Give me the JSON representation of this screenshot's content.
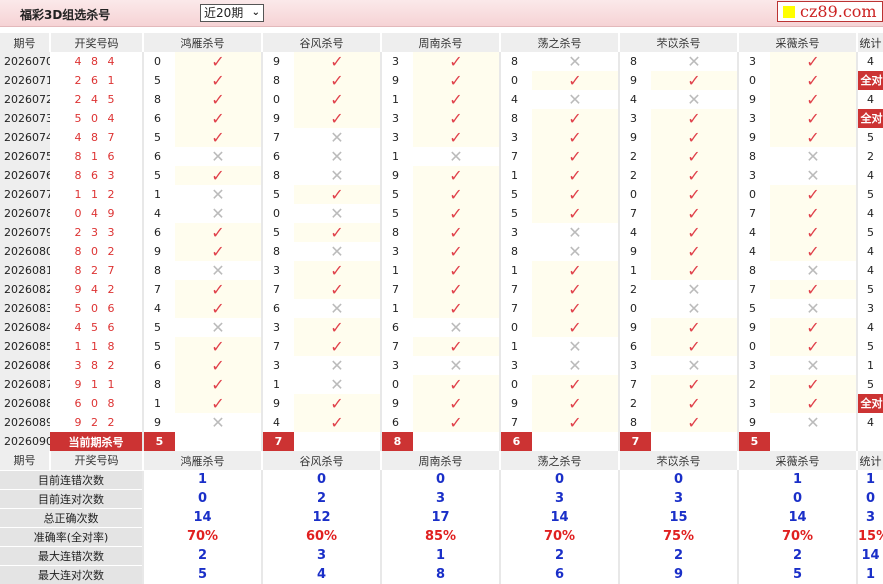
{
  "header": {
    "title": "福彩3D组选杀号",
    "period_select": "近20期",
    "logo": "cz89.com"
  },
  "columns": {
    "issue": "期号",
    "draw": "开奖号码",
    "experts": [
      "鸿雁杀号",
      "谷风杀号",
      "周南杀号",
      "荡之杀号",
      "芣苡杀号",
      "采薇杀号"
    ],
    "stat": "统计"
  },
  "marks": {
    "ok": "✓",
    "bad": "✕"
  },
  "colors": {
    "accent": "#cc3333",
    "ok": "#e0404a",
    "stat_blue": "#1a2fc8",
    "stat_red": "#e02020"
  },
  "rows": [
    {
      "issue": "2026070",
      "draw": "4 8 4",
      "kills": [
        0,
        9,
        3,
        8,
        8,
        3
      ],
      "ok": [
        1,
        1,
        1,
        0,
        0,
        1
      ],
      "stat": "4"
    },
    {
      "issue": "2026071",
      "draw": "2 6 1",
      "kills": [
        5,
        8,
        9,
        0,
        9,
        0
      ],
      "ok": [
        1,
        1,
        1,
        1,
        1,
        1
      ],
      "stat": "全对"
    },
    {
      "issue": "2026072",
      "draw": "2 4 5",
      "kills": [
        8,
        0,
        1,
        4,
        4,
        9
      ],
      "ok": [
        1,
        1,
        1,
        0,
        0,
        1
      ],
      "stat": "4"
    },
    {
      "issue": "2026073",
      "draw": "5 0 4",
      "kills": [
        6,
        9,
        3,
        8,
        3,
        3
      ],
      "ok": [
        1,
        1,
        1,
        1,
        1,
        1
      ],
      "stat": "全对"
    },
    {
      "issue": "2026074",
      "draw": "4 8 7",
      "kills": [
        5,
        7,
        3,
        3,
        9,
        9
      ],
      "ok": [
        1,
        0,
        1,
        1,
        1,
        1
      ],
      "stat": "5"
    },
    {
      "issue": "2026075",
      "draw": "8 1 6",
      "kills": [
        6,
        6,
        1,
        7,
        2,
        8
      ],
      "ok": [
        0,
        0,
        0,
        1,
        1,
        0
      ],
      "stat": "2"
    },
    {
      "issue": "2026076",
      "draw": "8 6 3",
      "kills": [
        5,
        8,
        9,
        1,
        2,
        3
      ],
      "ok": [
        1,
        0,
        1,
        1,
        1,
        0
      ],
      "stat": "4"
    },
    {
      "issue": "2026077",
      "draw": "1 1 2",
      "kills": [
        1,
        5,
        5,
        5,
        0,
        0
      ],
      "ok": [
        0,
        1,
        1,
        1,
        1,
        1
      ],
      "stat": "5"
    },
    {
      "issue": "2026078",
      "draw": "0 4 9",
      "kills": [
        4,
        0,
        5,
        5,
        7,
        7
      ],
      "ok": [
        0,
        0,
        1,
        1,
        1,
        1
      ],
      "stat": "4"
    },
    {
      "issue": "2026079",
      "draw": "2 3 3",
      "kills": [
        6,
        5,
        8,
        3,
        4,
        4
      ],
      "ok": [
        1,
        1,
        1,
        0,
        1,
        1
      ],
      "stat": "5"
    },
    {
      "issue": "2026080",
      "draw": "8 0 2",
      "kills": [
        9,
        8,
        3,
        8,
        9,
        4
      ],
      "ok": [
        1,
        0,
        1,
        0,
        1,
        1
      ],
      "stat": "4"
    },
    {
      "issue": "2026081",
      "draw": "8 2 7",
      "kills": [
        8,
        3,
        1,
        1,
        1,
        8
      ],
      "ok": [
        0,
        1,
        1,
        1,
        1,
        0
      ],
      "stat": "4"
    },
    {
      "issue": "2026082",
      "draw": "9 4 2",
      "kills": [
        7,
        7,
        7,
        7,
        2,
        7
      ],
      "ok": [
        1,
        1,
        1,
        1,
        0,
        1
      ],
      "stat": "5"
    },
    {
      "issue": "2026083",
      "draw": "5 0 6",
      "kills": [
        4,
        6,
        1,
        7,
        0,
        5
      ],
      "ok": [
        1,
        0,
        1,
        1,
        0,
        0
      ],
      "stat": "3"
    },
    {
      "issue": "2026084",
      "draw": "4 5 6",
      "kills": [
        5,
        3,
        6,
        0,
        9,
        9
      ],
      "ok": [
        0,
        1,
        0,
        1,
        1,
        1
      ],
      "stat": "4"
    },
    {
      "issue": "2026085",
      "draw": "1 1 8",
      "kills": [
        5,
        7,
        7,
        1,
        6,
        0
      ],
      "ok": [
        1,
        1,
        1,
        0,
        1,
        1
      ],
      "stat": "5"
    },
    {
      "issue": "2026086",
      "draw": "3 8 2",
      "kills": [
        6,
        3,
        3,
        3,
        3,
        3
      ],
      "ok": [
        1,
        0,
        0,
        0,
        0,
        0
      ],
      "stat": "1"
    },
    {
      "issue": "2026087",
      "draw": "9 1 1",
      "kills": [
        8,
        1,
        0,
        0,
        7,
        2
      ],
      "ok": [
        1,
        0,
        1,
        1,
        1,
        1
      ],
      "stat": "5"
    },
    {
      "issue": "2026088",
      "draw": "6 0 8",
      "kills": [
        1,
        9,
        9,
        9,
        2,
        3
      ],
      "ok": [
        1,
        1,
        1,
        1,
        1,
        1
      ],
      "stat": "全对"
    },
    {
      "issue": "2026089",
      "draw": "9 2 2",
      "kills": [
        9,
        4,
        6,
        7,
        8,
        9
      ],
      "ok": [
        0,
        1,
        1,
        1,
        1,
        0
      ],
      "stat": "4"
    }
  ],
  "current": {
    "issue": "2026090",
    "label": "当前期杀号",
    "kills": [
      5,
      7,
      8,
      6,
      7,
      5
    ]
  },
  "stats": [
    {
      "label": "目前连错次数",
      "values": [
        "1",
        "0",
        "0",
        "0",
        "0",
        "1"
      ],
      "total": "1"
    },
    {
      "label": "目前连对次数",
      "values": [
        "0",
        "2",
        "3",
        "3",
        "3",
        "0"
      ],
      "total": "0"
    },
    {
      "label": "总正确次数",
      "values": [
        "14",
        "12",
        "17",
        "14",
        "15",
        "14"
      ],
      "total": "3"
    },
    {
      "label": "准确率(全对率)",
      "values": [
        "70%",
        "60%",
        "85%",
        "70%",
        "75%",
        "70%"
      ],
      "total": "15%",
      "red": true
    },
    {
      "label": "最大连错次数",
      "values": [
        "2",
        "3",
        "1",
        "2",
        "2",
        "2"
      ],
      "total": "14"
    },
    {
      "label": "最大连对次数",
      "values": [
        "5",
        "4",
        "8",
        "6",
        "9",
        "5"
      ],
      "total": "1"
    }
  ]
}
